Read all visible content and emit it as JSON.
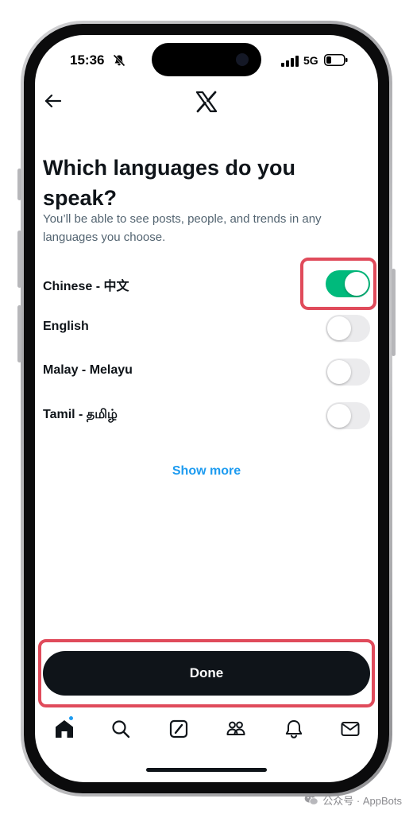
{
  "status_bar": {
    "time": "15:36",
    "network": "5G",
    "icons": [
      "bell-off-icon",
      "signal-icon",
      "battery-icon"
    ]
  },
  "header": {
    "back_icon": "arrow-left-icon",
    "logo": "x-logo-icon"
  },
  "content": {
    "title": "Which languages do you speak?",
    "subtitle": "You’ll be able to see posts, people, and trends in any languages you choose.",
    "languages": [
      {
        "label": "Chinese - 中文",
        "enabled": true
      },
      {
        "label": "English",
        "enabled": false
      },
      {
        "label": "Malay - Melayu",
        "enabled": false
      },
      {
        "label": "Tamil - தமிழ்",
        "enabled": false
      }
    ],
    "show_more_label": "Show more"
  },
  "footer": {
    "done_label": "Done"
  },
  "tab_bar": {
    "items": [
      {
        "name": "home-icon",
        "active": true,
        "has_notification_dot": true
      },
      {
        "name": "search-icon",
        "active": false
      },
      {
        "name": "grok-icon",
        "active": false
      },
      {
        "name": "communities-icon",
        "active": false
      },
      {
        "name": "notifications-bell-icon",
        "active": false
      },
      {
        "name": "messages-mail-icon",
        "active": false
      }
    ]
  },
  "watermark": {
    "text": "公众号 · AppBots"
  },
  "colors": {
    "toggle_on": "#00ba7c",
    "toggle_off": "#ebebed",
    "link": "#1d9bf0",
    "primary_text": "#0f1419",
    "secondary_text": "#536471",
    "highlight": "#e04b5b",
    "button_bg": "#0f1419"
  }
}
